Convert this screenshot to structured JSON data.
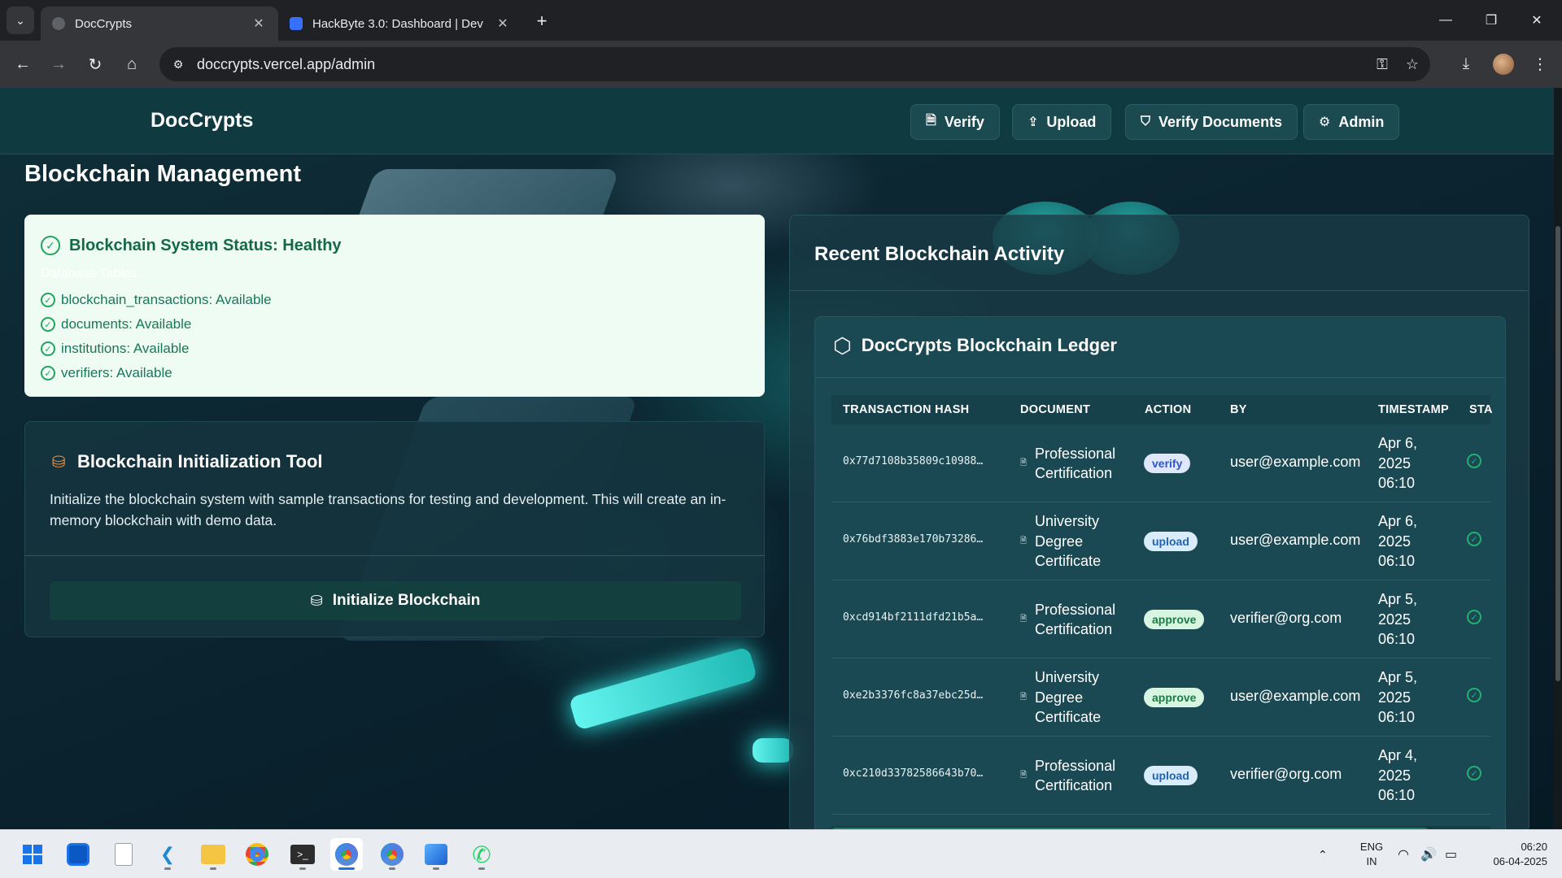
{
  "browser": {
    "tabs": [
      {
        "title": "DocCrypts",
        "active": true
      },
      {
        "title": "HackByte 3.0: Dashboard | Dev",
        "active": false
      }
    ],
    "url": "doccrypts.vercel.app/admin"
  },
  "navbar": {
    "brand": "DocCrypts",
    "items": [
      {
        "label": "Verify",
        "icon": "file-check-icon"
      },
      {
        "label": "Upload",
        "icon": "upload-icon"
      },
      {
        "label": "Verify Documents",
        "icon": "shield-icon"
      },
      {
        "label": "Admin",
        "icon": "gear-icon"
      }
    ]
  },
  "page": {
    "title": "Blockchain Management"
  },
  "status_card": {
    "heading": "Blockchain System Status: Healthy",
    "tables_label": "Database Tables:",
    "tables": [
      "blockchain_transactions: Available",
      "documents: Available",
      "institutions: Available",
      "verifiers: Available"
    ]
  },
  "init_tool": {
    "heading": "Blockchain Initialization Tool",
    "description": "Initialize the blockchain system with sample transactions for testing and development. This will create an in-memory blockchain with demo data.",
    "button_label": "Initialize Blockchain"
  },
  "activity": {
    "title": "Recent Blockchain Activity",
    "ledger_title": "DocCrypts Blockchain Ledger",
    "columns": [
      "TRANSACTION HASH",
      "DOCUMENT",
      "ACTION",
      "BY",
      "TIMESTAMP",
      "STA"
    ],
    "rows": [
      {
        "hash": "0x77d7108b35809c10988…",
        "document": "Professional Certification",
        "action": "verify",
        "by": "user@example.com",
        "timestamp": "Apr 6, 2025 06:10"
      },
      {
        "hash": "0x76bdf3883e170b73286…",
        "document": "University Degree Certificate",
        "action": "upload",
        "by": "user@example.com",
        "timestamp": "Apr 6, 2025 06:10"
      },
      {
        "hash": "0xcd914bf2111dfd21b5a…",
        "document": "Professional Certification",
        "action": "approve",
        "by": "verifier@org.com",
        "timestamp": "Apr 5, 2025 06:10"
      },
      {
        "hash": "0xe2b3376fc8a37ebc25d…",
        "document": "University Degree Certificate",
        "action": "approve",
        "by": "user@example.com",
        "timestamp": "Apr 5, 2025 06:10"
      },
      {
        "hash": "0xc210d33782586643b70…",
        "document": "Professional Certification",
        "action": "upload",
        "by": "verifier@org.com",
        "timestamp": "Apr 4, 2025 06:10"
      }
    ]
  },
  "taskbar": {
    "lang_line1": "ENG",
    "lang_line2": "IN",
    "time": "06:20",
    "date": "06-04-2025"
  }
}
